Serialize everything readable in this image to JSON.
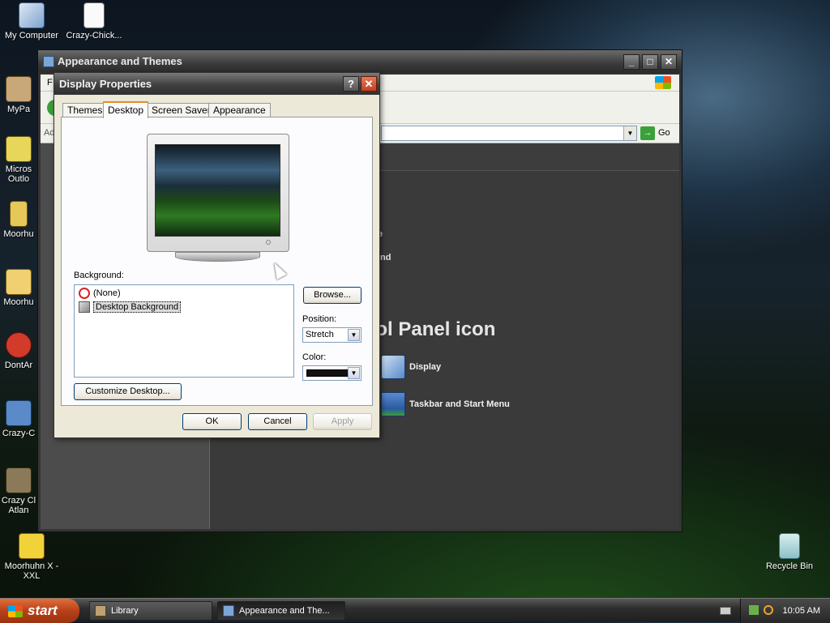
{
  "desktop": {
    "icons": [
      {
        "label": "My Computer"
      },
      {
        "label": "Crazy-Chick..."
      },
      {
        "label": "MyPa"
      },
      {
        "label": "Micros Outlo"
      },
      {
        "label": "Moorhu"
      },
      {
        "label": "Moorhu"
      },
      {
        "label": "DontAr"
      },
      {
        "label": "Crazy-C"
      },
      {
        "label": "Crazy Cl Atlan"
      },
      {
        "label": "Moorhuhn X - XXL"
      },
      {
        "label": "Recycle Bin"
      }
    ]
  },
  "back_window": {
    "title": "Appearance and Themes",
    "menu_letter": "F",
    "address_label": "Ad",
    "go_label": "Go",
    "main": {
      "fragment_1": "e",
      "fragment_2": "nd",
      "pick_title": "rol Panel icon",
      "items": [
        {
          "label": "Display",
          "icon": "display-icon"
        },
        {
          "label": "Taskbar and Start Menu",
          "icon": "taskbar-icon"
        }
      ]
    }
  },
  "dialog": {
    "title": "Display Properties",
    "help_glyph": "?",
    "close_glyph": "✕",
    "tabs": [
      {
        "label": "Themes"
      },
      {
        "label": "Desktop",
        "active": true
      },
      {
        "label": "Screen Saver"
      },
      {
        "label": "Appearance"
      }
    ],
    "background_label": "Background:",
    "backgrounds": [
      {
        "label": "(None)",
        "icon": "none-icon"
      },
      {
        "label": "Desktop Background",
        "icon": "picture-icon",
        "selected": true
      }
    ],
    "browse_label": "Browse...",
    "position_label": "Position:",
    "position_value": "Stretch",
    "color_label": "Color:",
    "color_value": "#111111",
    "customize_label": "Customize Desktop...",
    "ok_label": "OK",
    "cancel_label": "Cancel",
    "apply_label": "Apply"
  },
  "taskbar": {
    "start_label": "start",
    "tasks": [
      {
        "label": "Library"
      },
      {
        "label": "Appearance and The..."
      }
    ],
    "clock": "10:05 AM"
  }
}
